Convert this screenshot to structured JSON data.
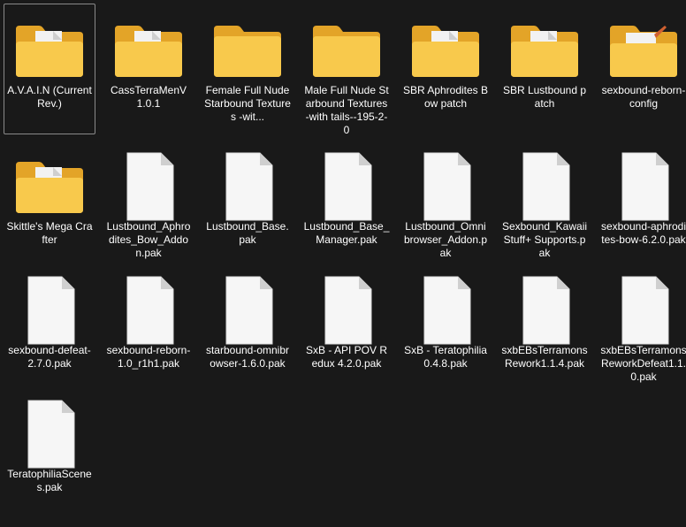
{
  "items": [
    {
      "label": "A.V.A.I.N (Current Rev.)",
      "type": "folder-doc",
      "selected": true
    },
    {
      "label": "CassTerraMenV 1.0.1",
      "type": "folder-doc"
    },
    {
      "label": "Female Full Nude Starbound Textures -wit...",
      "type": "folder"
    },
    {
      "label": "Male Full Nude Starbound Textures -with tails--195-2-0",
      "type": "folder"
    },
    {
      "label": "SBR Aphrodites Bow patch",
      "type": "folder-doc"
    },
    {
      "label": "SBR Lustbound patch",
      "type": "folder-doc"
    },
    {
      "label": "sexbound-reborn-config",
      "type": "folder-art"
    },
    {
      "label": "Skittle's Mega Crafter",
      "type": "folder-doc"
    },
    {
      "label": "Lustbound_Aphrodites_Bow_Addon.pak",
      "type": "file"
    },
    {
      "label": "Lustbound_Base.pak",
      "type": "file"
    },
    {
      "label": "Lustbound_Base_Manager.pak",
      "type": "file"
    },
    {
      "label": "Lustbound_Omnibrowser_Addon.pak",
      "type": "file"
    },
    {
      "label": "Sexbound_KawaiiStuff+ Supports.pak",
      "type": "file"
    },
    {
      "label": "sexbound-aphrodites-bow-6.2.0.pak",
      "type": "file"
    },
    {
      "label": "sexbound-defeat-2.7.0.pak",
      "type": "file"
    },
    {
      "label": "sexbound-reborn-1.0_r1h1.pak",
      "type": "file"
    },
    {
      "label": "starbound-omnibrowser-1.6.0.pak",
      "type": "file"
    },
    {
      "label": "SxB - API POV Redux 4.2.0.pak",
      "type": "file"
    },
    {
      "label": "SxB - Teratophilia 0.4.8.pak",
      "type": "file"
    },
    {
      "label": "sxbEBsTerramonsRework1.1.4.pak",
      "type": "file"
    },
    {
      "label": "sxbEBsTerramonsReworkDefeat1.1.0.pak",
      "type": "file"
    },
    {
      "label": "TeratophiliaScenes.pak",
      "type": "file"
    }
  ],
  "colors": {
    "background": "#191919",
    "folder_back": "#e8a92a",
    "folder_front": "#f7c748",
    "file_page": "#f5f5f5",
    "file_fold": "#cfcfcf"
  }
}
